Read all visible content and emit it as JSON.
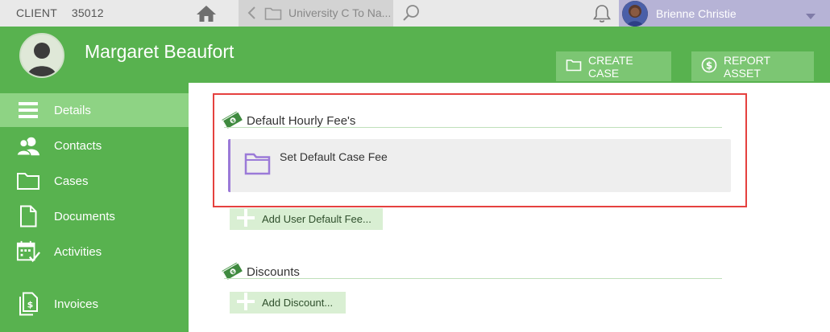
{
  "topbar": {
    "client_label": "CLIENT",
    "client_number": "35012",
    "tab_label": "University C To Na...",
    "user_name": "Brienne Christie"
  },
  "header": {
    "person_name": "Margaret Beaufort",
    "create_case_label": "CREATE CASE",
    "report_asset_label": "REPORT ASSET"
  },
  "sidebar": {
    "items": [
      {
        "label": "Details",
        "icon": "list-icon"
      },
      {
        "label": "Contacts",
        "icon": "contacts-icon"
      },
      {
        "label": "Cases",
        "icon": "folder-icon"
      },
      {
        "label": "Documents",
        "icon": "document-icon"
      },
      {
        "label": "Activities",
        "icon": "calendar-check-icon"
      },
      {
        "label": "Invoices",
        "icon": "invoice-icon"
      }
    ]
  },
  "main": {
    "hourly_fee_title": "Default Hourly Fee's",
    "fee_item_label": "Set Default Case Fee",
    "add_user_fee_label": "Add User Default Fee...",
    "discounts_title": "Discounts",
    "add_discount_label": "Add Discount..."
  },
  "colors": {
    "brand_green": "#58b24f",
    "active_nav": "#8ed384",
    "highlight_red": "#e5413f",
    "fee_accent_purple": "#9b7ad8"
  }
}
